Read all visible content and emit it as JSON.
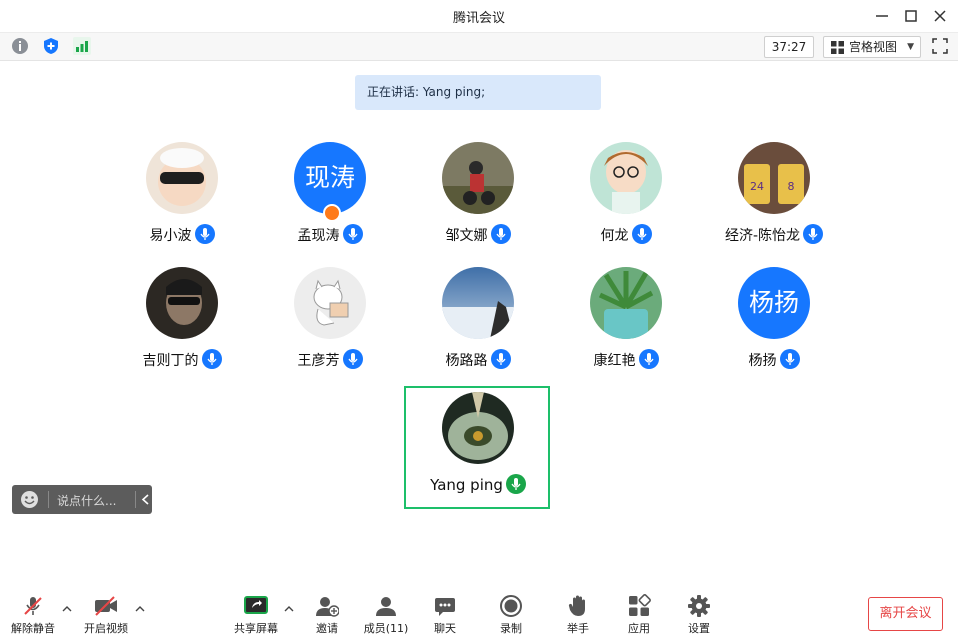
{
  "window": {
    "title": "腾讯会议"
  },
  "toolbar": {
    "timer": "37:27",
    "view_mode": "宫格视图"
  },
  "speaking": {
    "label": "正在讲话: Yang ping;"
  },
  "participants": [
    {
      "name": "易小波",
      "avatar": "photo",
      "color": "#e9d7c8"
    },
    {
      "name": "孟现涛",
      "avatar_text": "现涛",
      "host": true
    },
    {
      "name": "邹文娜",
      "avatar": "photo",
      "color": "#6d6a52"
    },
    {
      "name": "何龙",
      "avatar": "photo",
      "color": "#9fd6c8"
    },
    {
      "name": "经济-陈怡龙",
      "avatar": "photo",
      "color": "#7c5a43"
    },
    {
      "name": "吉则丁的",
      "avatar": "photo",
      "color": "#3a3530"
    },
    {
      "name": "王彦芳",
      "avatar": "photo",
      "color": "#ececec"
    },
    {
      "name": "杨路路",
      "avatar": "photo",
      "color": "#6f8fb3"
    },
    {
      "name": "康红艳",
      "avatar": "photo",
      "color": "#4f9a63"
    },
    {
      "name": "杨扬",
      "avatar_text": "杨扬"
    },
    {
      "name": "Yang ping",
      "avatar": "photo",
      "color": "#2c3a2e",
      "speaking": true
    }
  ],
  "chat": {
    "placeholder": "说点什么..."
  },
  "bottom": {
    "unmute": "解除静音",
    "video": "开启视频",
    "share": "共享屏幕",
    "invite": "邀请",
    "members": "成员(11)",
    "chat": "聊天",
    "record": "录制",
    "raise_hand": "举手",
    "apps": "应用",
    "settings": "设置",
    "leave": "离开会议"
  },
  "colors": {
    "accent": "#1677ff",
    "speaking_border": "#1dbf6a",
    "danger": "#e64646"
  }
}
